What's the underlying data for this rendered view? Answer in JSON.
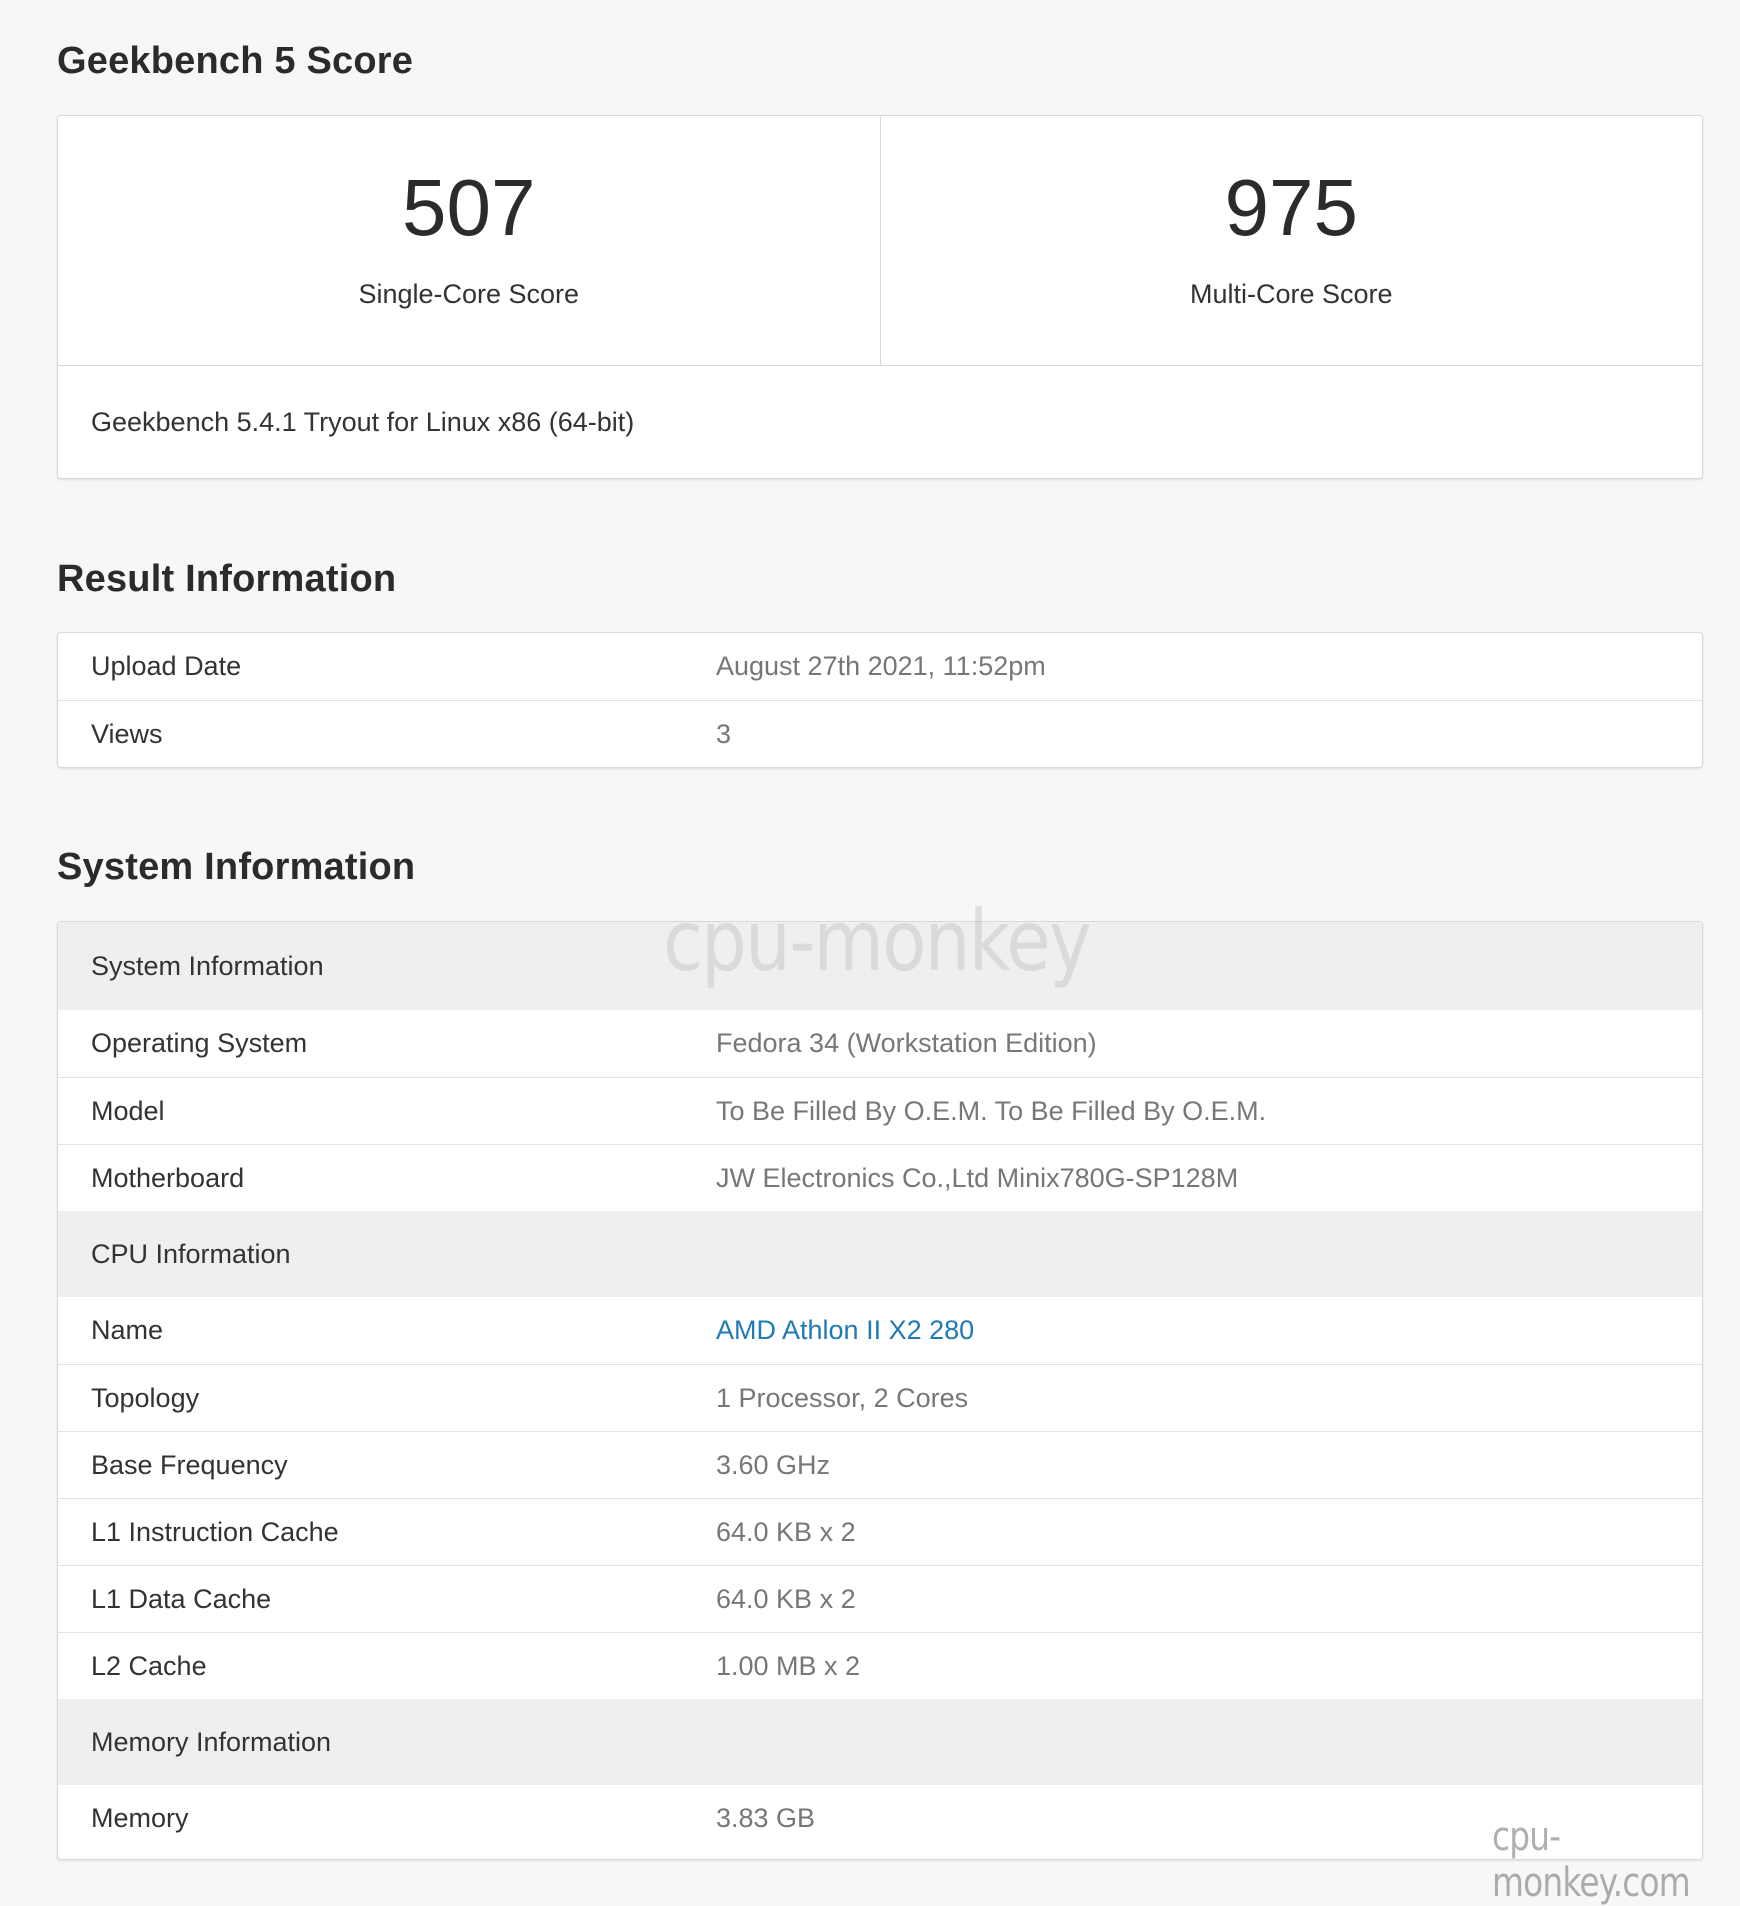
{
  "score_section": {
    "title": "Geekbench 5 Score",
    "single_core": {
      "value": "507",
      "label": "Single-Core Score"
    },
    "multi_core": {
      "value": "975",
      "label": "Multi-Core Score"
    },
    "version": "Geekbench 5.4.1 Tryout for Linux x86 (64-bit)"
  },
  "result_section": {
    "title": "Result Information",
    "rows": [
      {
        "label": "Upload Date",
        "value": "August 27th 2021, 11:52pm"
      },
      {
        "label": "Views",
        "value": "3"
      }
    ]
  },
  "system_section": {
    "title": "System Information",
    "groups": [
      {
        "header": "System Information",
        "rows": [
          {
            "label": "Operating System",
            "value": "Fedora 34 (Workstation Edition)"
          },
          {
            "label": "Model",
            "value": "To Be Filled By O.E.M. To Be Filled By O.E.M."
          },
          {
            "label": "Motherboard",
            "value": "JW Electronics Co.,Ltd Minix780G-SP128M"
          }
        ]
      },
      {
        "header": "CPU Information",
        "rows": [
          {
            "label": "Name",
            "value": "AMD Athlon II X2 280"
          },
          {
            "label": "Topology",
            "value": "1 Processor, 2 Cores"
          },
          {
            "label": "Base Frequency",
            "value": "3.60 GHz"
          },
          {
            "label": "L1 Instruction Cache",
            "value": "64.0 KB x 2"
          },
          {
            "label": "L1 Data Cache",
            "value": "64.0 KB x 2"
          },
          {
            "label": "L2 Cache",
            "value": "1.00 MB x 2"
          }
        ]
      },
      {
        "header": "Memory Information",
        "rows": [
          {
            "label": "Memory",
            "value": "3.83 GB"
          }
        ]
      }
    ]
  },
  "watermarks": {
    "center": "cpu-monkey",
    "corner": "cpu-monkey.com"
  },
  "colors": {
    "link": "#1f7ab5",
    "value_text": "#777777",
    "section_header_bg": "#efefef",
    "page_bg": "#f7f7f7"
  }
}
